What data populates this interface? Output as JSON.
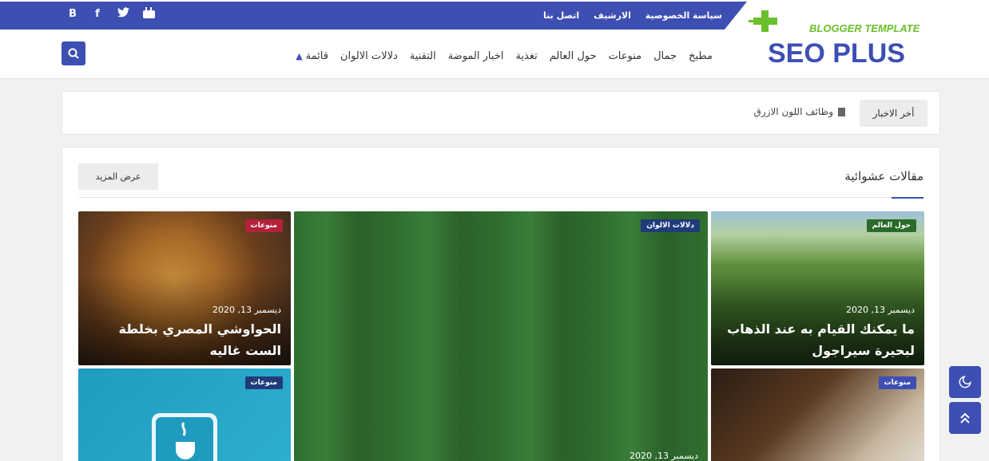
{
  "social": {
    "icons": [
      "blogger-icon",
      "facebook-icon",
      "twitter-icon",
      "youtube-icon"
    ],
    "blogger_glyph": "B",
    "facebook_glyph": "f"
  },
  "top_links": [
    "سياسة الخصوصية",
    "الارشيف",
    "اتصل بنا"
  ],
  "logo": {
    "tagline": "BLOGGER TEMPLATE",
    "name": "SEO PLUS"
  },
  "nav": [
    "مطبخ",
    "جمال",
    "منوعات",
    "حول العالم",
    "تغذية",
    "اخبار الموضة",
    "التقنية",
    "دلالات الالوان",
    "قائمة"
  ],
  "ticker": {
    "label": "أخر الاخبار",
    "item": "وظائف اللون الازرق"
  },
  "section": {
    "title": "مقالات عشوائية",
    "more": "عرض المزيد"
  },
  "posts": [
    {
      "badge": "حول العالم",
      "date": "ديسمبر 13, 2020",
      "title": "ما يمكنك القيام به عند الذهاب لبحيرة سيراجول"
    },
    {
      "badge": "منوعات",
      "date": "",
      "title": ""
    },
    {
      "badge": "دلالات الالوان",
      "date": "ديسمبر 13, 2020",
      "title": ""
    },
    {
      "badge": "منوعات",
      "date": "ديسمبر 13, 2020",
      "title": "الحواوشي المصري بخلطة الست غاليه"
    },
    {
      "badge": "منوعات",
      "date": "",
      "title": ""
    }
  ],
  "colors": {
    "accent": "#3d4fb3",
    "badge_green": "#2a6b2a",
    "badge_red": "#b3213a",
    "badge_navy": "#1f3b7a"
  }
}
